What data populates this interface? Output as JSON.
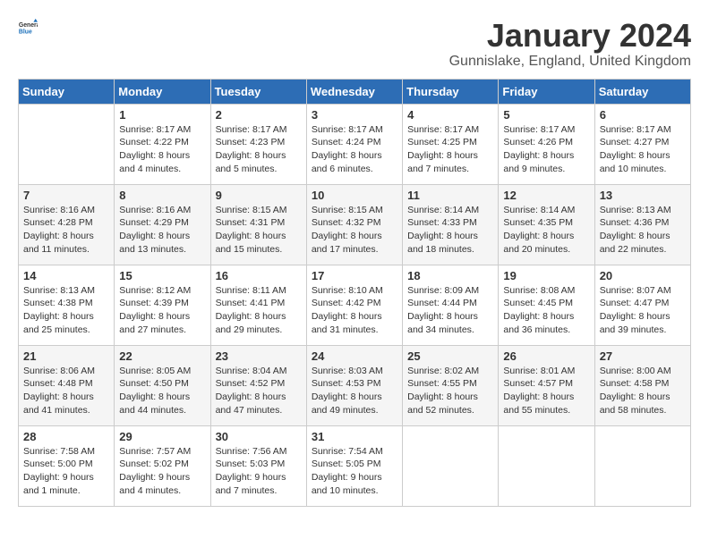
{
  "header": {
    "logo_general": "General",
    "logo_blue": "Blue",
    "title": "January 2024",
    "subtitle": "Gunnislake, England, United Kingdom"
  },
  "columns": [
    "Sunday",
    "Monday",
    "Tuesday",
    "Wednesday",
    "Thursday",
    "Friday",
    "Saturday"
  ],
  "weeks": [
    [
      {
        "day": "",
        "sunrise": "",
        "sunset": "",
        "daylight": "",
        "empty": true
      },
      {
        "day": "1",
        "sunrise": "Sunrise: 8:17 AM",
        "sunset": "Sunset: 4:22 PM",
        "daylight": "Daylight: 8 hours and 4 minutes."
      },
      {
        "day": "2",
        "sunrise": "Sunrise: 8:17 AM",
        "sunset": "Sunset: 4:23 PM",
        "daylight": "Daylight: 8 hours and 5 minutes."
      },
      {
        "day": "3",
        "sunrise": "Sunrise: 8:17 AM",
        "sunset": "Sunset: 4:24 PM",
        "daylight": "Daylight: 8 hours and 6 minutes."
      },
      {
        "day": "4",
        "sunrise": "Sunrise: 8:17 AM",
        "sunset": "Sunset: 4:25 PM",
        "daylight": "Daylight: 8 hours and 7 minutes."
      },
      {
        "day": "5",
        "sunrise": "Sunrise: 8:17 AM",
        "sunset": "Sunset: 4:26 PM",
        "daylight": "Daylight: 8 hours and 9 minutes."
      },
      {
        "day": "6",
        "sunrise": "Sunrise: 8:17 AM",
        "sunset": "Sunset: 4:27 PM",
        "daylight": "Daylight: 8 hours and 10 minutes."
      }
    ],
    [
      {
        "day": "7",
        "sunrise": "Sunrise: 8:16 AM",
        "sunset": "Sunset: 4:28 PM",
        "daylight": "Daylight: 8 hours and 11 minutes."
      },
      {
        "day": "8",
        "sunrise": "Sunrise: 8:16 AM",
        "sunset": "Sunset: 4:29 PM",
        "daylight": "Daylight: 8 hours and 13 minutes."
      },
      {
        "day": "9",
        "sunrise": "Sunrise: 8:15 AM",
        "sunset": "Sunset: 4:31 PM",
        "daylight": "Daylight: 8 hours and 15 minutes."
      },
      {
        "day": "10",
        "sunrise": "Sunrise: 8:15 AM",
        "sunset": "Sunset: 4:32 PM",
        "daylight": "Daylight: 8 hours and 17 minutes."
      },
      {
        "day": "11",
        "sunrise": "Sunrise: 8:14 AM",
        "sunset": "Sunset: 4:33 PM",
        "daylight": "Daylight: 8 hours and 18 minutes."
      },
      {
        "day": "12",
        "sunrise": "Sunrise: 8:14 AM",
        "sunset": "Sunset: 4:35 PM",
        "daylight": "Daylight: 8 hours and 20 minutes."
      },
      {
        "day": "13",
        "sunrise": "Sunrise: 8:13 AM",
        "sunset": "Sunset: 4:36 PM",
        "daylight": "Daylight: 8 hours and 22 minutes."
      }
    ],
    [
      {
        "day": "14",
        "sunrise": "Sunrise: 8:13 AM",
        "sunset": "Sunset: 4:38 PM",
        "daylight": "Daylight: 8 hours and 25 minutes."
      },
      {
        "day": "15",
        "sunrise": "Sunrise: 8:12 AM",
        "sunset": "Sunset: 4:39 PM",
        "daylight": "Daylight: 8 hours and 27 minutes."
      },
      {
        "day": "16",
        "sunrise": "Sunrise: 8:11 AM",
        "sunset": "Sunset: 4:41 PM",
        "daylight": "Daylight: 8 hours and 29 minutes."
      },
      {
        "day": "17",
        "sunrise": "Sunrise: 8:10 AM",
        "sunset": "Sunset: 4:42 PM",
        "daylight": "Daylight: 8 hours and 31 minutes."
      },
      {
        "day": "18",
        "sunrise": "Sunrise: 8:09 AM",
        "sunset": "Sunset: 4:44 PM",
        "daylight": "Daylight: 8 hours and 34 minutes."
      },
      {
        "day": "19",
        "sunrise": "Sunrise: 8:08 AM",
        "sunset": "Sunset: 4:45 PM",
        "daylight": "Daylight: 8 hours and 36 minutes."
      },
      {
        "day": "20",
        "sunrise": "Sunrise: 8:07 AM",
        "sunset": "Sunset: 4:47 PM",
        "daylight": "Daylight: 8 hours and 39 minutes."
      }
    ],
    [
      {
        "day": "21",
        "sunrise": "Sunrise: 8:06 AM",
        "sunset": "Sunset: 4:48 PM",
        "daylight": "Daylight: 8 hours and 41 minutes."
      },
      {
        "day": "22",
        "sunrise": "Sunrise: 8:05 AM",
        "sunset": "Sunset: 4:50 PM",
        "daylight": "Daylight: 8 hours and 44 minutes."
      },
      {
        "day": "23",
        "sunrise": "Sunrise: 8:04 AM",
        "sunset": "Sunset: 4:52 PM",
        "daylight": "Daylight: 8 hours and 47 minutes."
      },
      {
        "day": "24",
        "sunrise": "Sunrise: 8:03 AM",
        "sunset": "Sunset: 4:53 PM",
        "daylight": "Daylight: 8 hours and 49 minutes."
      },
      {
        "day": "25",
        "sunrise": "Sunrise: 8:02 AM",
        "sunset": "Sunset: 4:55 PM",
        "daylight": "Daylight: 8 hours and 52 minutes."
      },
      {
        "day": "26",
        "sunrise": "Sunrise: 8:01 AM",
        "sunset": "Sunset: 4:57 PM",
        "daylight": "Daylight: 8 hours and 55 minutes."
      },
      {
        "day": "27",
        "sunrise": "Sunrise: 8:00 AM",
        "sunset": "Sunset: 4:58 PM",
        "daylight": "Daylight: 8 hours and 58 minutes."
      }
    ],
    [
      {
        "day": "28",
        "sunrise": "Sunrise: 7:58 AM",
        "sunset": "Sunset: 5:00 PM",
        "daylight": "Daylight: 9 hours and 1 minute."
      },
      {
        "day": "29",
        "sunrise": "Sunrise: 7:57 AM",
        "sunset": "Sunset: 5:02 PM",
        "daylight": "Daylight: 9 hours and 4 minutes."
      },
      {
        "day": "30",
        "sunrise": "Sunrise: 7:56 AM",
        "sunset": "Sunset: 5:03 PM",
        "daylight": "Daylight: 9 hours and 7 minutes."
      },
      {
        "day": "31",
        "sunrise": "Sunrise: 7:54 AM",
        "sunset": "Sunset: 5:05 PM",
        "daylight": "Daylight: 9 hours and 10 minutes."
      },
      {
        "day": "",
        "sunrise": "",
        "sunset": "",
        "daylight": "",
        "empty": true
      },
      {
        "day": "",
        "sunrise": "",
        "sunset": "",
        "daylight": "",
        "empty": true
      },
      {
        "day": "",
        "sunrise": "",
        "sunset": "",
        "daylight": "",
        "empty": true
      }
    ]
  ]
}
